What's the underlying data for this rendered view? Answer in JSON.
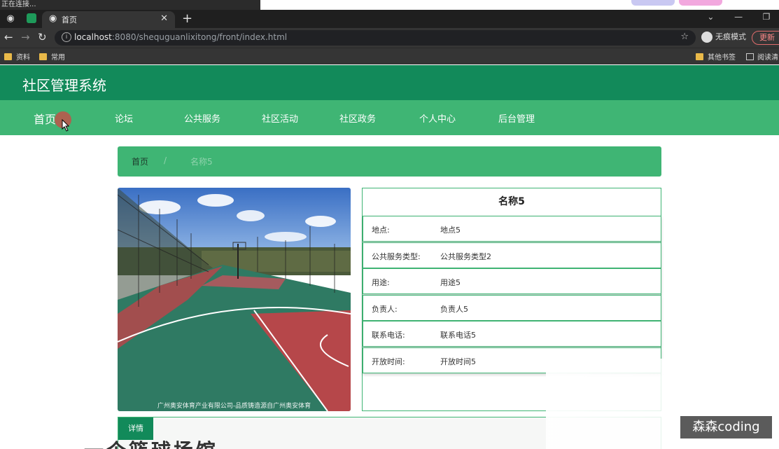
{
  "browser": {
    "status_text": "正在连接...",
    "tab_title": "首页",
    "new_tab": "+",
    "url_host": "localhost",
    "url_path": ":8080/shequguanlixitong/front/index.html",
    "incognito_label": "无痕模式",
    "update_label": "更新",
    "bookmarks": [
      "资料",
      "常用"
    ],
    "bookmarks_right": [
      "其他书签",
      "阅读清"
    ]
  },
  "site": {
    "title": "社区管理系统",
    "nav": [
      "首页",
      "论坛",
      "公共服务",
      "社区活动",
      "社区政务",
      "个人中心",
      "后台管理"
    ]
  },
  "breadcrumb": {
    "home": "首页",
    "separator": "/",
    "current": "名称5"
  },
  "photo": {
    "caption": "广州奥安体育产业有限公司-品质铸造源自广州奥安体育"
  },
  "detail": {
    "title": "名称5",
    "rows": [
      {
        "label": "地点:",
        "value": "地点5"
      },
      {
        "label": "公共服务类型:",
        "value": "公共服务类型2"
      },
      {
        "label": "用途:",
        "value": "用途5"
      },
      {
        "label": "负责人:",
        "value": "负责人5"
      },
      {
        "label": "联系电话:",
        "value": "联系电话5"
      },
      {
        "label": "开放时间:",
        "value": "开放时间5"
      }
    ],
    "tab_label": "详情"
  },
  "bottom": {
    "partial_heading": "一个篮球场馆"
  },
  "watermark": "森森coding",
  "colors": {
    "header_green": "#128a5a",
    "nav_green": "#3fb574"
  }
}
